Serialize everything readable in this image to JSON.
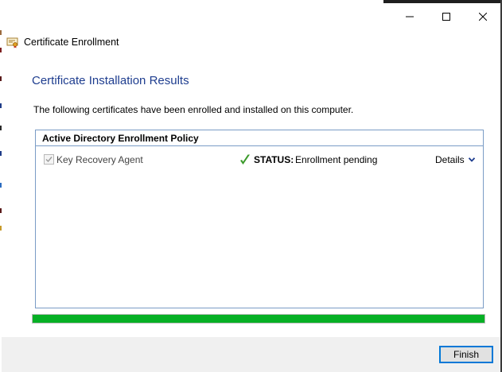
{
  "window": {
    "app_title": "Certificate Enrollment",
    "icons": {
      "app": "certificate-icon",
      "minimize": "minimize-icon",
      "maximize": "maximize-icon",
      "close": "close-icon"
    }
  },
  "page": {
    "title": "Certificate Installation Results",
    "description": "The following certificates have been enrolled and installed on this computer."
  },
  "results": {
    "policy_name": "Active Directory Enrollment Policy",
    "certificates": [
      {
        "name": "Key Recovery Agent",
        "checked": true,
        "status_label": "STATUS:",
        "status_value": "Enrollment pending",
        "status_icon": "checkmark-icon",
        "details_label": "Details"
      }
    ]
  },
  "progress": {
    "percent": 100,
    "color": "#06b025"
  },
  "footer": {
    "finish_label": "Finish"
  },
  "colors": {
    "title_blue": "#1e3d8f",
    "box_border": "#7a9cc6",
    "accent": "#0078d7",
    "check_green": "#3a9a2a"
  }
}
